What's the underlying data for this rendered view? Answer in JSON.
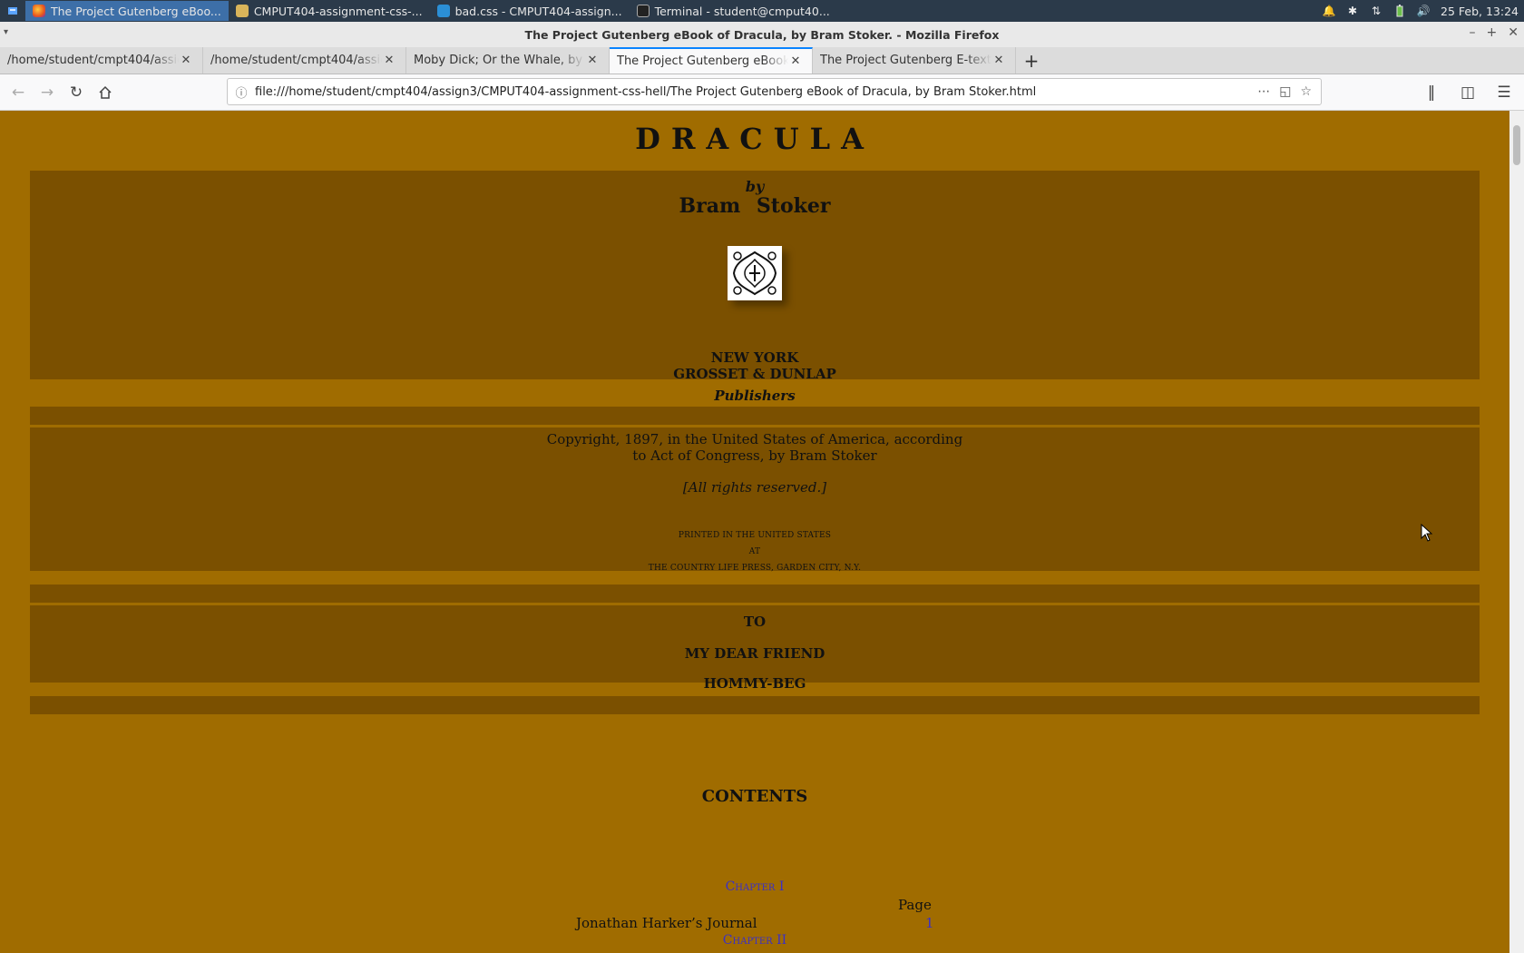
{
  "system_panel": {
    "tasks": [
      {
        "label": "The Project Gutenberg eBoo...",
        "icon": "firefox-icon",
        "active": true
      },
      {
        "label": "CMPUT404-assignment-css-...",
        "icon": "folder-icon",
        "active": false
      },
      {
        "label": "bad.css - CMPUT404-assign...",
        "icon": "vscode-icon",
        "active": false
      },
      {
        "label": "Terminal - student@cmput40...",
        "icon": "terminal-icon",
        "active": false
      }
    ],
    "clock": "25 Feb, 13:24"
  },
  "window": {
    "title": "The Project Gutenberg eBook of Dracula, by Bram Stoker. - Mozilla Firefox"
  },
  "tabs": [
    {
      "label": "/home/student/cmpt404/assign3/",
      "active": false
    },
    {
      "label": "/home/student/cmpt404/assign3/",
      "active": false
    },
    {
      "label": "Moby Dick; Or the Whale, by Herm",
      "active": false
    },
    {
      "label": "The Project Gutenberg eBook of D",
      "active": true
    },
    {
      "label": "The Project Gutenberg E-text of F",
      "active": false
    }
  ],
  "navbar": {
    "url": "file:///home/student/cmpt404/assign3/CMPUT404-assignment-css-hell/The Project Gutenberg eBook of Dracula, by Bram Stoker.html"
  },
  "page": {
    "title": "DRACULA",
    "by": "by",
    "author": "Bram Stoker",
    "publisher": {
      "city": "NEW YORK",
      "name": "GROSSET & DUNLAP",
      "role": "Publishers"
    },
    "copyright": {
      "line1": "Copyright, 1897, in the United States of America, according",
      "line2": "to Act of Congress, by Bram Stoker",
      "rights": "[All rights reserved.]",
      "printed1": "PRINTED IN THE UNITED STATES",
      "printed2": "AT",
      "printed3": "THE COUNTRY LIFE PRESS, GARDEN CITY, N.Y."
    },
    "dedication": {
      "to": "TO",
      "friend": "MY DEAR FRIEND",
      "name": "HOMMY-BEG"
    },
    "contents_heading": "CONTENTS",
    "toc": {
      "chapter1": "Chapter I",
      "page_header": "Page",
      "entry1_title": "Jonathan Harker’s Journal",
      "entry1_page": "1",
      "chapter2": "Chapter II"
    }
  },
  "colors": {
    "page_background": "#a06c00",
    "band_background": "#7b5000",
    "link": "#3a2fc8"
  }
}
